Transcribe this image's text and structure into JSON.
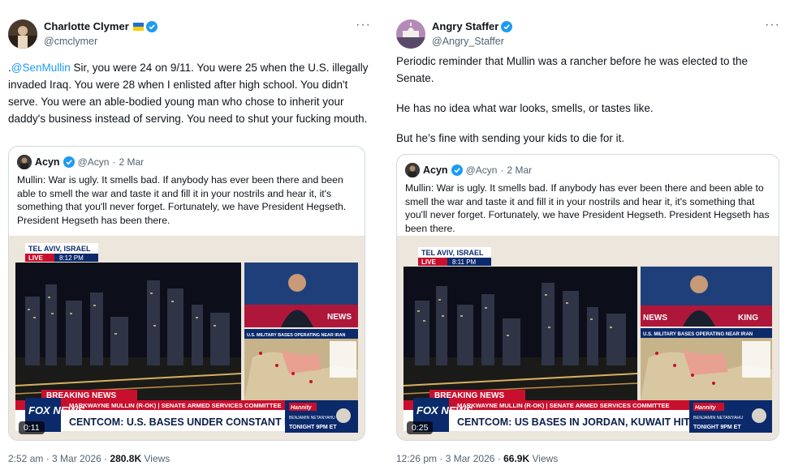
{
  "tweets": [
    {
      "author": {
        "name": "Charlotte Clymer",
        "handle": "@cmclymer",
        "flag": "ukraine-flag",
        "verified": true
      },
      "more": "···",
      "text_prefix": ".",
      "mention": "@SenMullin",
      "text": " Sir, you were 24 on 9/11. You were 25 when the U.S. illegally invaded Iraq. You were 28 when I enlisted after high school. You didn't serve. You were an able-bodied young man who chose to inherit your daddy's business instead of serving. You need to shut your fucking mouth.",
      "quote": {
        "name": "Acyn",
        "handle": "@Acyn",
        "dot": "·",
        "date": "2 Mar",
        "text": "Mullin: War is ugly. It smells bad. If anybody has ever been there and been able to smell the war and taste it and fill it in your nostrils and hear it, it's something that you'll never forget. Fortunately, we have President Hegseth. President Hegseth has been there.",
        "video": {
          "location": "TEL AVIV, ISRAEL",
          "live": "LIVE",
          "time": "8:12 PM",
          "map_title": "U.S. MILITARY BASES OPERATING NEAR IRAN",
          "side_label": "NEWS",
          "breaking": "BREAKING NEWS",
          "lower_third": "MARKWAYNE MULLIN (R-OK) | SENATE ARMED SERVICES COMMITTEE",
          "headline": "CENTCOM: U.S. BASES UNDER CONSTANT FIRE",
          "promo_show": "Hannity",
          "promo_guest": "BENJAMIN NETANYAHU",
          "promo_time": "TONIGHT 9PM ET",
          "channel": "FOX NEWS",
          "duration": "0:11"
        }
      },
      "time": "2:52 am",
      "dot": "·",
      "date": "3 Mar 2026",
      "dot2": "·",
      "views_count": "280.8K",
      "views_label": "Views"
    },
    {
      "author": {
        "name": "Angry Staffer",
        "handle": "@Angry_Staffer",
        "verified": true
      },
      "more": "···",
      "paragraphs": [
        "Periodic reminder that Mullin was a rancher before he was elected to the Senate.",
        "He has no idea what war looks, smells, or tastes like.",
        "But he’s fine with sending your kids to die for it."
      ],
      "quote": {
        "name": "Acyn",
        "handle": "@Acyn",
        "dot": "·",
        "date": "2 Mar",
        "text": "Mullin: War is ugly. It smells bad. If anybody has ever been there and been able to smell the war and taste it and fill it in your nostrils and hear it, it's something that you'll never forget. Fortunately, we have President Hegseth. President Hegseth has been there.",
        "video": {
          "location": "TEL AVIV, ISRAEL",
          "live": "LIVE",
          "time": "8:11 PM",
          "map_title": "U.S. MILITARY BASES OPERATING NEAR IRAN",
          "side_label": "KING",
          "side_prefix": "NEWS",
          "breaking": "BREAKING NEWS",
          "lower_third": "MARKWAYNE MULLIN (R-OK) | SENATE ARMED SERVICES COMMITTEE",
          "headline": "CENTCOM: US BASES IN JORDAN, KUWAIT HIT",
          "promo_show": "Hannity",
          "promo_guest": "BENJAMIN NETANYAHU",
          "promo_time": "TONIGHT 9PM ET",
          "channel": "FOX NEWS",
          "duration": "0:25"
        }
      },
      "time": "12:26 pm",
      "dot": "·",
      "date": "3 Mar 2026",
      "dot2": "·",
      "views_count": "66.9K",
      "views_label": "Views"
    }
  ],
  "colors": {
    "link": "#1d9bf0",
    "muted": "#536471",
    "fox_red": "#c8102e",
    "fox_blue": "#0b2a6b"
  }
}
